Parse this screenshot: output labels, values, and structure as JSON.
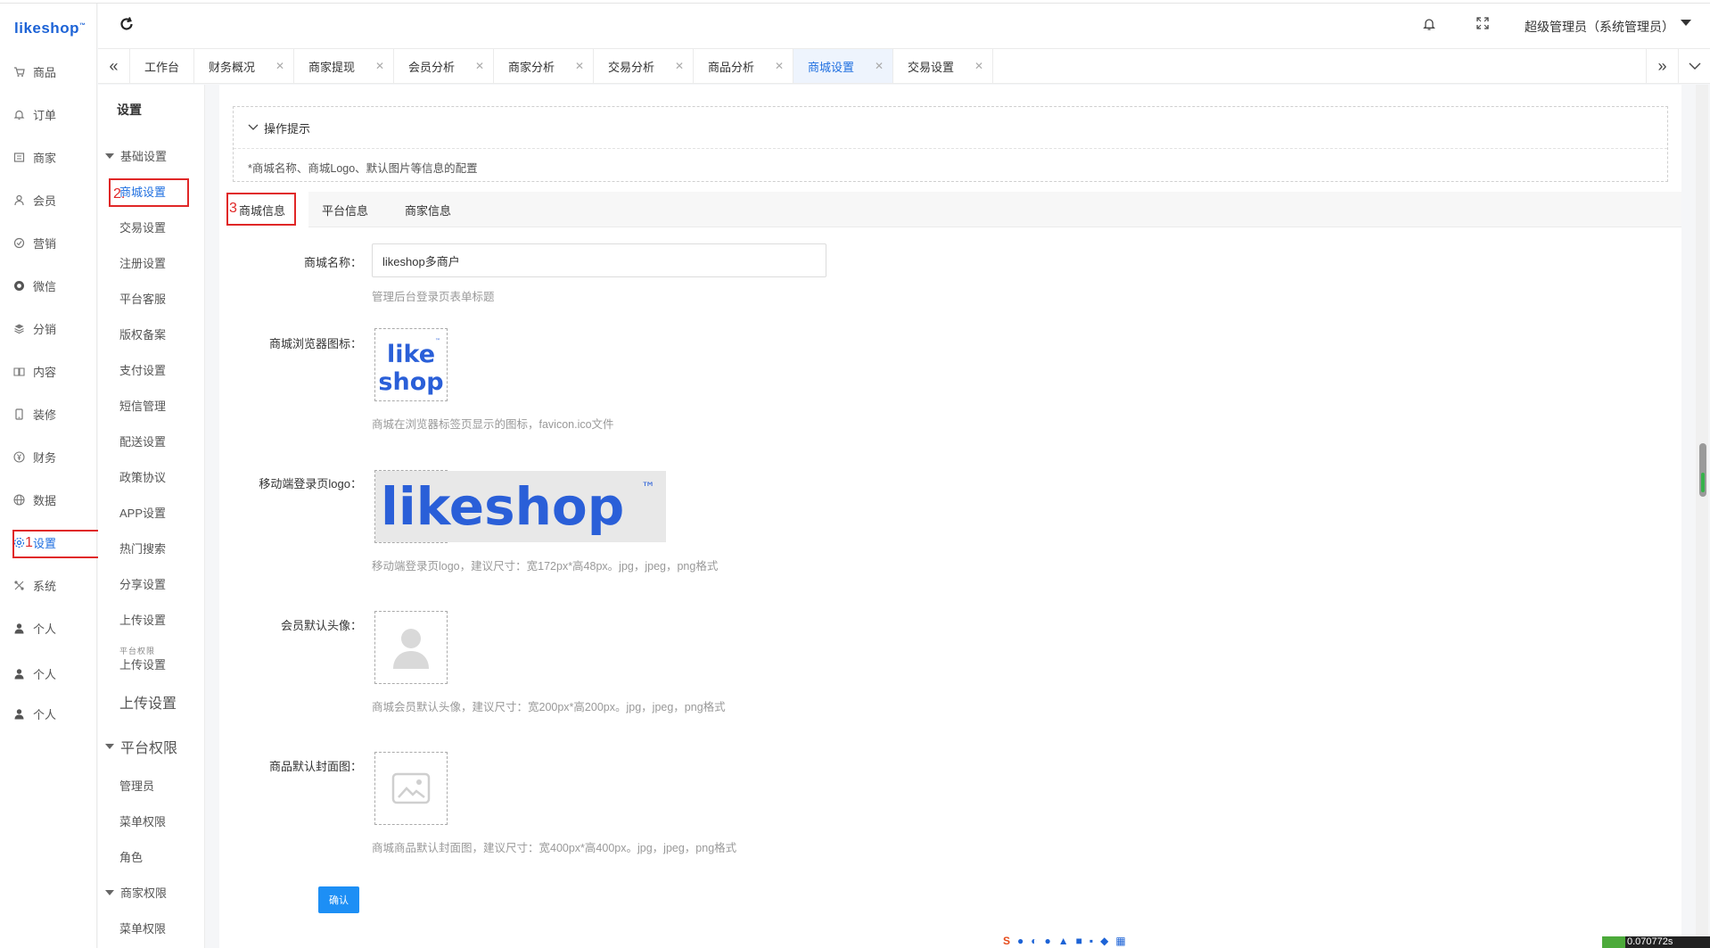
{
  "app": {
    "logo": "likeshop",
    "logo_tm": "™",
    "user": "超级管理员（系统管理员）"
  },
  "sidebar": {
    "items": [
      {
        "label": "商品",
        "icon": "cart-icon"
      },
      {
        "label": "订单",
        "icon": "bell-icon"
      },
      {
        "label": "商家",
        "icon": "store-icon"
      },
      {
        "label": "会员",
        "icon": "user-icon"
      },
      {
        "label": "营销",
        "icon": "gift-icon"
      },
      {
        "label": "微信",
        "icon": "wechat-icon"
      },
      {
        "label": "分销",
        "icon": "layers-icon"
      },
      {
        "label": "内容",
        "icon": "book-icon"
      },
      {
        "label": "装修",
        "icon": "mobile-icon"
      },
      {
        "label": "财务",
        "icon": "yen-icon"
      },
      {
        "label": "数据",
        "icon": "globe-icon"
      },
      {
        "label": "设置",
        "icon": "gear-icon",
        "active": true
      },
      {
        "label": "系统",
        "icon": "tools-icon"
      },
      {
        "label": "个人",
        "icon": "person-icon"
      },
      {
        "label": "个人",
        "icon": "person-icon"
      },
      {
        "label": "个人",
        "icon": "person-icon"
      }
    ]
  },
  "tabs": [
    {
      "label": "工作台",
      "closable": false
    },
    {
      "label": "财务概况",
      "closable": true
    },
    {
      "label": "商家提现",
      "closable": true
    },
    {
      "label": "会员分析",
      "closable": true
    },
    {
      "label": "商家分析",
      "closable": true
    },
    {
      "label": "交易分析",
      "closable": true
    },
    {
      "label": "商品分析",
      "closable": true
    },
    {
      "label": "商城设置",
      "closable": true,
      "active": true
    },
    {
      "label": "交易设置",
      "closable": true
    }
  ],
  "submenu": {
    "title": "设置",
    "group_basic": "基础设置",
    "items_basic": [
      "商城设置",
      "交易设置",
      "注册设置",
      "平台客服",
      "版权备案",
      "支付设置",
      "短信管理",
      "配送设置",
      "政策协议",
      "APP设置",
      "热门搜索",
      "分享设置",
      "上传设置"
    ],
    "ghost_1": "平台权限",
    "ghost_2": "上传设置",
    "ghost_3": "上传设置",
    "group_platform": "平台权限",
    "items_platform": [
      "管理员",
      "菜单权限",
      "角色"
    ],
    "group_merchant": "商家权限",
    "items_merchant": [
      "菜单权限"
    ]
  },
  "tips": {
    "title": "操作提示",
    "text": "*商城名称、商城Logo、默认图片等信息的配置"
  },
  "form_tabs": [
    "商城信息",
    "平台信息",
    "商家信息"
  ],
  "form": {
    "name_label": "商城名称：",
    "name_value": "likeshop多商户",
    "name_help": "管理后台登录页表单标题",
    "favicon_label": "商城浏览器图标：",
    "favicon_logo_top": "like",
    "favicon_logo_bottom": "shop",
    "favicon_help": "商城在浏览器标签页显示的图标，favicon.ico文件",
    "mobile_logo_label": "移动端登录页logo：",
    "mobile_logo_text": "likeshop",
    "mobile_logo_help": "移动端登录页logo，建议尺寸：宽172px*高48px。jpg，jpeg，png格式",
    "avatar_label": "会员默认头像：",
    "avatar_help": "商城会员默认头像，建议尺寸：宽200px*高200px。jpg，jpeg，png格式",
    "cover_label": "商品默认封面图：",
    "cover_help": "商城商品默认封面图，建议尺寸：宽400px*高400px。jpg，jpeg，png格式",
    "confirm_label": "确认"
  },
  "annotations": [
    "1",
    "2.",
    "3"
  ],
  "overlay": {
    "speed_text": "0.070772s"
  },
  "colors": {
    "accent": "#1f6fe0",
    "annotation": "#e02727",
    "confirm": "#1d8ff5"
  }
}
